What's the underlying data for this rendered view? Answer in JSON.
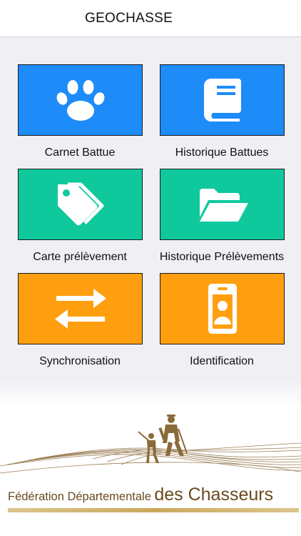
{
  "header": {
    "title": "GEOCHASSE"
  },
  "menu": [
    {
      "label": "Carnet Battue",
      "icon": "paw-icon",
      "color": "#1d8cf8"
    },
    {
      "label": "Historique Battues",
      "icon": "book-icon",
      "color": "#1d8cf8"
    },
    {
      "label": "Carte prélèvement",
      "icon": "tags-icon",
      "color": "#0fc99d"
    },
    {
      "label": "Historique Prélèvements",
      "icon": "folder-open-icon",
      "color": "#0fc99d"
    },
    {
      "label": "Synchronisation",
      "icon": "exchange-arrows-icon",
      "color": "#ff9f0f"
    },
    {
      "label": "Identification",
      "icon": "id-badge-icon",
      "color": "#ff9f0f"
    }
  ],
  "footer": {
    "logo_line1": "Fédération Départementale",
    "logo_line2": "des Chasseurs",
    "logo_icon": "hunters-silhouette-icon"
  }
}
